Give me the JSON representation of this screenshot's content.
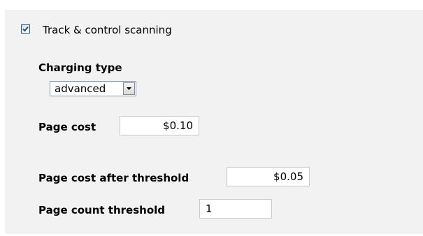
{
  "scanning": {
    "checkbox_checked": true,
    "checkbox_label": "Track & control scanning"
  },
  "charging_type": {
    "label": "Charging type",
    "selected": "advanced"
  },
  "page_cost": {
    "label": "Page cost",
    "value": "$0.10"
  },
  "page_cost_after_threshold": {
    "label": "Page cost after threshold",
    "value": "$0.05"
  },
  "page_count_threshold": {
    "label": "Page count threshold",
    "value": "1"
  },
  "colors": {
    "panel_background": "#f2f2f2",
    "checkmark": "#214e8c"
  }
}
